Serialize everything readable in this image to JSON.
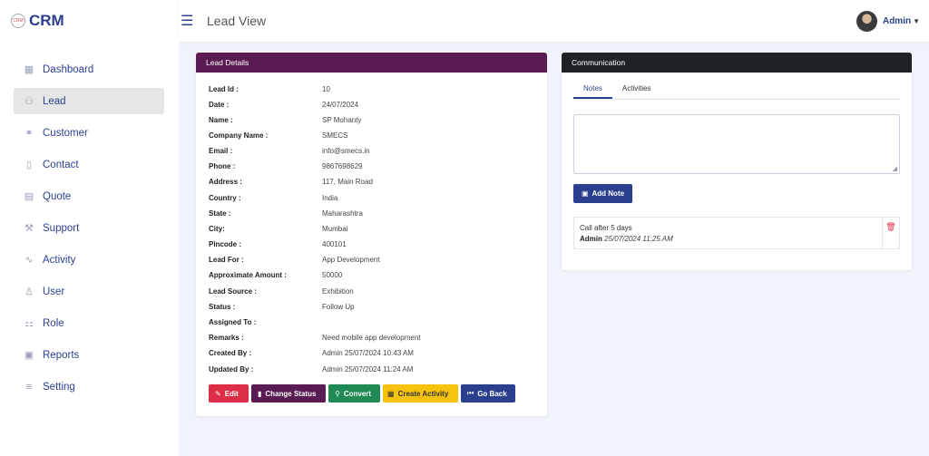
{
  "app": {
    "brand": "CRM",
    "logo_text": "CRM"
  },
  "topbar": {
    "title": "Lead View",
    "user_name": "Admin"
  },
  "sidebar": {
    "items": [
      {
        "label": "Dashboard",
        "icon": "grid-icon",
        "active": false
      },
      {
        "label": "Lead",
        "icon": "users-icon",
        "active": true
      },
      {
        "label": "Customer",
        "icon": "people-icon",
        "active": false
      },
      {
        "label": "Contact",
        "icon": "phone-icon",
        "active": false
      },
      {
        "label": "Quote",
        "icon": "document-icon",
        "active": false
      },
      {
        "label": "Support",
        "icon": "tools-icon",
        "active": false
      },
      {
        "label": "Activity",
        "icon": "pulse-icon",
        "active": false
      },
      {
        "label": "User",
        "icon": "user-icon",
        "active": false
      },
      {
        "label": "Role",
        "icon": "hierarchy-icon",
        "active": false
      },
      {
        "label": "Reports",
        "icon": "report-icon",
        "active": false
      },
      {
        "label": "Setting",
        "icon": "list-icon",
        "active": false
      }
    ]
  },
  "lead": {
    "header": "Lead Details",
    "fields": [
      {
        "label": "Lead Id :",
        "value": "10"
      },
      {
        "label": "Date :",
        "value": "24/07/2024"
      },
      {
        "label": "Name :",
        "value": "SP Mohanty"
      },
      {
        "label": "Company Name :",
        "value": "SMECS"
      },
      {
        "label": "Email :",
        "value": "info@smecs.in"
      },
      {
        "label": "Phone :",
        "value": "9867698629"
      },
      {
        "label": "Address :",
        "value": "117, Main Road"
      },
      {
        "label": "Country :",
        "value": "India"
      },
      {
        "label": "State :",
        "value": "Maharashtra"
      },
      {
        "label": "City:",
        "value": "Mumbai"
      },
      {
        "label": "Pincode :",
        "value": "400101"
      },
      {
        "label": "Lead For :",
        "value": "App Development"
      },
      {
        "label": "Approximate Amount :",
        "value": "50000"
      },
      {
        "label": "Lead Source :",
        "value": "Exhibition"
      },
      {
        "label": "Status :",
        "value": "Follow Up"
      },
      {
        "label": "Assigned To :",
        "value": ""
      },
      {
        "label": "Remarks :",
        "value": "Need mobile app development"
      },
      {
        "label": "Created By :",
        "value": "Admin 25/07/2024 10:43 AM"
      },
      {
        "label": "Updated By :",
        "value": "Admin 25/07/2024 11:24 AM"
      }
    ],
    "buttons": {
      "edit": "Edit",
      "change_status": "Change Status",
      "convert": "Convert",
      "create_activity": "Create Activity",
      "go_back": "Go Back"
    }
  },
  "communication": {
    "header": "Communication",
    "tabs": [
      "Notes",
      "Activities"
    ],
    "note_placeholder": "",
    "add_note_label": "Add Note",
    "notes": [
      {
        "text": "Call after 5 days",
        "author": "Admin",
        "timestamp": "25/07/2024 11:25 AM"
      }
    ]
  },
  "colors": {
    "primary": "#2b3f8f",
    "lead_header": "#5a1a52",
    "comm_header": "#1e2226",
    "danger": "#dc2f47",
    "success": "#1f8a53",
    "warning": "#f6c20e"
  }
}
